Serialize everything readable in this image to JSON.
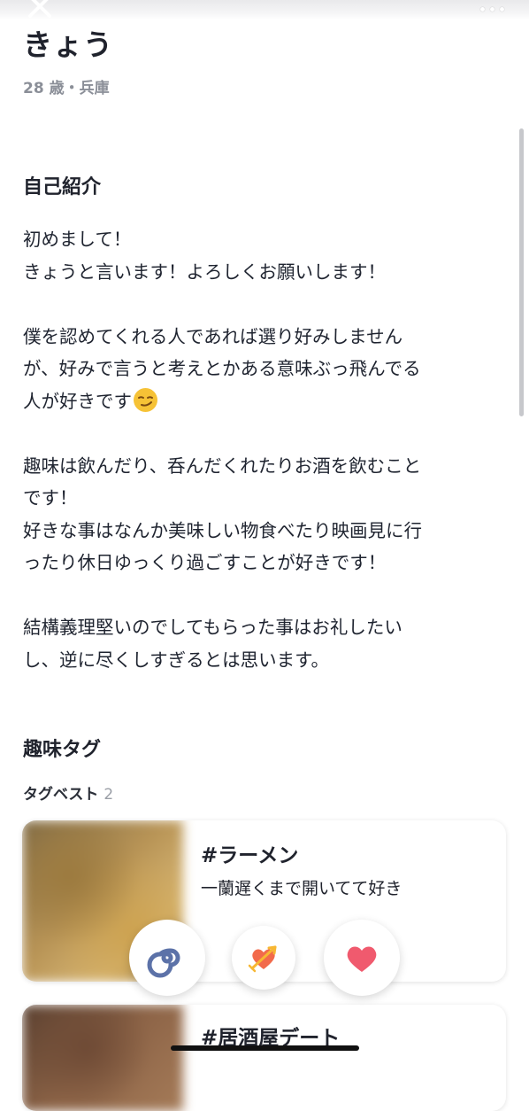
{
  "profile": {
    "name": "きょう",
    "age_location": "28 歳・兵庫"
  },
  "intro": {
    "title": "自己紹介",
    "lines": [
      "初めまして！",
      "きょうと言います！よろしくお願いします！",
      "",
      "僕を認めてくれる人であれば選り好みしません",
      "が、好みで言うと考えとかある意味ぶっ飛んでる",
      "人が好きです",
      "",
      "趣味は飲んだり、呑んだくれたりお酒を飲むこと",
      "です！",
      "好きな事はなんか美味しい物食べたり映画見に行",
      "ったり休日ゆっくり過ごすことが好きです！",
      "",
      "結構義理堅いのでしてもらった事はお礼したい",
      "し、逆に尽くしすぎるとは思います。"
    ],
    "emoji_icon": "smirking-face-emoji"
  },
  "hobby_tags": {
    "title": "趣味タグ",
    "subtitle": "タグベスト",
    "count": "2",
    "cards": [
      {
        "title": "#ラーメン",
        "description": "一蘭遅くまで開いてて好き"
      },
      {
        "title": "#居酒屋デート",
        "description": ""
      }
    ]
  },
  "actions": [
    {
      "name": "skip",
      "icon": "swirl-icon",
      "color": "#5c72a8"
    },
    {
      "name": "super-like",
      "icon": "heart-arrow-icon",
      "color": "#f26a4b"
    },
    {
      "name": "like",
      "icon": "heart-icon",
      "color": "#f05a6e"
    }
  ],
  "icons": {
    "close": "close-icon",
    "more": "more-icon"
  },
  "colors": {
    "text": "#1f2430",
    "muted": "#8b8f98",
    "accent_red": "#f05a6e"
  }
}
